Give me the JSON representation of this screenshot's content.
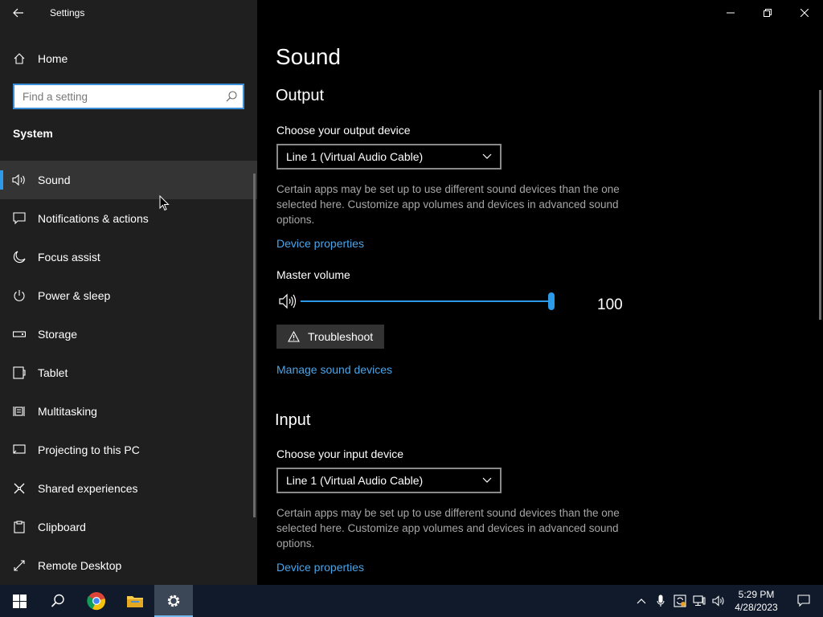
{
  "window": {
    "title": "Settings"
  },
  "sidebar": {
    "home_label": "Home",
    "search_placeholder": "Find a setting",
    "section": "System",
    "items": [
      {
        "label": "Sound",
        "icon": "speaker-icon",
        "active": true
      },
      {
        "label": "Notifications & actions",
        "icon": "notifications-icon"
      },
      {
        "label": "Focus assist",
        "icon": "moon-icon"
      },
      {
        "label": "Power & sleep",
        "icon": "power-icon"
      },
      {
        "label": "Storage",
        "icon": "storage-icon"
      },
      {
        "label": "Tablet",
        "icon": "tablet-icon"
      },
      {
        "label": "Multitasking",
        "icon": "multitasking-icon"
      },
      {
        "label": "Projecting to this PC",
        "icon": "projecting-icon"
      },
      {
        "label": "Shared experiences",
        "icon": "shared-icon"
      },
      {
        "label": "Clipboard",
        "icon": "clipboard-icon"
      },
      {
        "label": "Remote Desktop",
        "icon": "remote-desktop-icon"
      }
    ]
  },
  "main": {
    "title": "Sound",
    "output": {
      "heading": "Output",
      "device_label": "Choose your output device",
      "device_value": "Line 1 (Virtual Audio Cable)",
      "description": "Certain apps may be set up to use different sound devices than the one selected here. Customize app volumes and devices in advanced sound options.",
      "properties_link": "Device properties",
      "volume_label": "Master volume",
      "volume_value": "100",
      "volume_fraction": 1.0,
      "troubleshoot_label": "Troubleshoot",
      "manage_link": "Manage sound devices"
    },
    "input": {
      "heading": "Input",
      "device_label": "Choose your input device",
      "device_value": "Line 1 (Virtual Audio Cable)",
      "description": "Certain apps may be set up to use different sound devices than the one selected here. Customize app volumes and devices in advanced sound options.",
      "properties_link": "Device properties"
    }
  },
  "taskbar": {
    "time": "5:29 PM",
    "date": "4/28/2023"
  },
  "colors": {
    "accent": "#2c9ae8",
    "link": "#4ba5ea",
    "sidebar_bg": "#1f1f1f",
    "taskbar_bg": "#101a2b"
  }
}
